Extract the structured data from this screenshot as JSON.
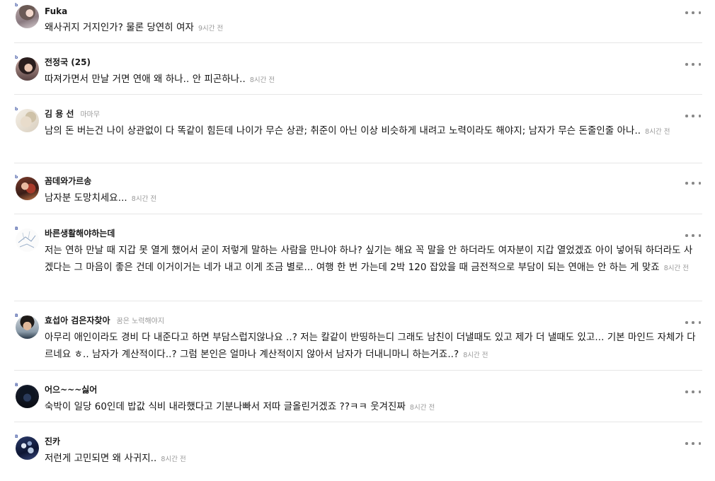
{
  "ui": {
    "more_icon": "more-horizontal-icon",
    "level_badge": "b"
  },
  "comments": [
    {
      "nickname": "Fuka",
      "subtitle": "",
      "text": "왜사귀지 거지인가? 물론 당연히 여자",
      "time": "9시간 전",
      "avatar": "avatar-photo",
      "badge": "b"
    },
    {
      "nickname": "전정국 (25)",
      "subtitle": "",
      "text": "따져가면서 만날 거면 연애 왜 하나.. 안 피곤하나..",
      "time": "8시간 전",
      "avatar": "avatar-photo",
      "badge": "b"
    },
    {
      "nickname": "김 용 선",
      "subtitle": "마마무",
      "text": "남의 돈 버는건 나이 상관없이 다 똑같이 힘든데 나이가 무슨 상관; 취준이 아닌 이상 비슷하게 내려고 노력이라도 해야지; 남자가 무슨 돈줄인줄 아나..",
      "time": "8시간 전",
      "avatar": "avatar-photo",
      "badge": "b"
    },
    {
      "nickname": "꼼데와가르송",
      "subtitle": "",
      "text": "남자분 도망치세요...",
      "time": "8시간 전",
      "avatar": "avatar-photo",
      "badge": "b"
    },
    {
      "nickname": "바른생활해야하는데",
      "subtitle": "",
      "text": "저는 연하 만날 때 지갑 못 열게 했어서 굳이 저렇게 말하는 사람을 만나야 하나? 싶기는 해요 꼭 말을 안 하더라도 여자분이 지갑 열었겠죠 아이 넣어둬 하더라도 사겠다는 그 마음이 좋은 건데 이거이거는 네가 내고 이게 조금 별로... 여행 한 번 가는데 2박 120 잡았을 때 금전적으로 부담이 되는 연애는 안 하는 게 맞죠",
      "time": "8시간 전",
      "avatar": "avatar-drawing",
      "badge": "B"
    },
    {
      "nickname": "효섭아 검은자찾아",
      "subtitle": "꿈은 노력해야지",
      "text": "아무리 애인이라도 경비 다 내준다고 하면 부담스럽지않나요 ..? 저는 칼같이 반띵하는디 그래도 남친이 더낼때도 있고 제가 더 낼때도 있고... 기본 마인드 자체가 다르네요 ㅎ.. 남자가 계산적이다..? 그럼 본인은 얼마나 계산적이지 않아서 남자가 더내니마니 하는거죠..?",
      "time": "8시간 전",
      "avatar": "avatar-photo",
      "badge": "B"
    },
    {
      "nickname": "어으~~~싫어",
      "subtitle": "",
      "text": "숙박이 일당 60인데 밥값 식비 내라했다고 기분나빠서 저따 글올린거겠죠 ??ㅋㅋ 웃겨진짜",
      "time": "8시간 전",
      "avatar": "avatar-photo",
      "badge": "B"
    },
    {
      "nickname": "진카",
      "subtitle": "",
      "text": " 저런게 고민되면 왜 사귀지..",
      "time": "8시간 전",
      "avatar": "avatar-photo",
      "badge": "B"
    }
  ]
}
